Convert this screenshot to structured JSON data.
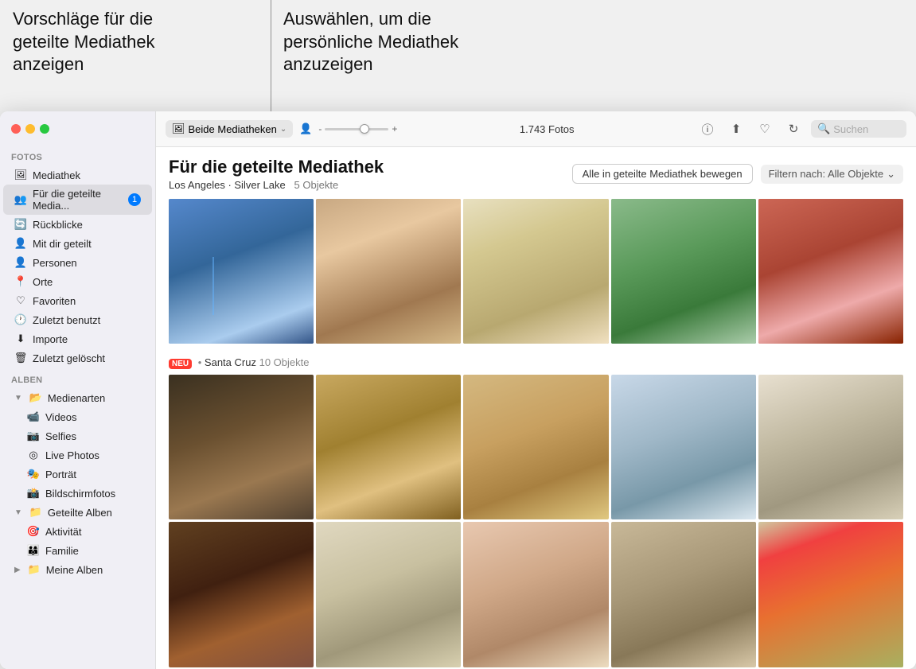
{
  "annotations": {
    "left": "Vorschläge für die\ngeteilte Mediathek\nanzeigen",
    "right": "Auswählen, um die\npersönliche Mediathek\nanzuzeigen"
  },
  "window": {
    "title": "Fotos"
  },
  "toolbar": {
    "library_picker_label": "Beide Mediatheken",
    "photo_count": "1.743 Fotos",
    "slider_minus": "-",
    "slider_plus": "+",
    "search_placeholder": "Suchen"
  },
  "sidebar": {
    "section_fotos": "Fotos",
    "items_fotos": [
      {
        "label": "Mediathek",
        "icon": "🖼",
        "active": false
      },
      {
        "label": "Für die geteilte Media...",
        "icon": "👥",
        "active": true,
        "badge": "1"
      },
      {
        "label": "Rückblicke",
        "icon": "🔄",
        "active": false
      },
      {
        "label": "Mit dir geteilt",
        "icon": "👤",
        "active": false
      },
      {
        "label": "Personen",
        "icon": "👤",
        "active": false
      },
      {
        "label": "Orte",
        "icon": "📍",
        "active": false
      },
      {
        "label": "Favoriten",
        "icon": "♡",
        "active": false
      },
      {
        "label": "Zuletzt benutzt",
        "icon": "🕐",
        "active": false
      },
      {
        "label": "Importe",
        "icon": "⬇",
        "active": false
      },
      {
        "label": "Zuletzt gelöscht",
        "icon": "🗑",
        "active": false
      }
    ],
    "section_alben": "Alben",
    "items_alben": [
      {
        "label": "Medienarten",
        "icon": "📂",
        "disclosure": true,
        "indent": 0
      },
      {
        "label": "Videos",
        "icon": "📹",
        "indent": 1
      },
      {
        "label": "Selfies",
        "icon": "📷",
        "indent": 1
      },
      {
        "label": "Live Photos",
        "icon": "◎",
        "indent": 1
      },
      {
        "label": "Porträt",
        "icon": "🎭",
        "indent": 1
      },
      {
        "label": "Bildschirmfotos",
        "icon": "📸",
        "indent": 1
      },
      {
        "label": "Geteilte Alben",
        "icon": "📁",
        "disclosure": true,
        "indent": 0
      },
      {
        "label": "Aktivität",
        "icon": "🎯",
        "indent": 1
      },
      {
        "label": "Familie",
        "icon": "👨‍👩‍👦",
        "indent": 1
      },
      {
        "label": "Meine Alben",
        "icon": "📁",
        "disclosure": true,
        "indent": 0,
        "collapsed": true
      }
    ]
  },
  "main": {
    "section_title": "Für die geteilte Mediathek",
    "move_btn": "Alle in geteilte Mediathek bewegen",
    "filter_btn": "Filtern nach: Alle Objekte",
    "location_1": "Los Angeles · Silver Lake",
    "count_1": "5 Objekte",
    "badge_new": "NEU",
    "location_2": "Santa Cruz",
    "count_2": "10 Objekte"
  }
}
